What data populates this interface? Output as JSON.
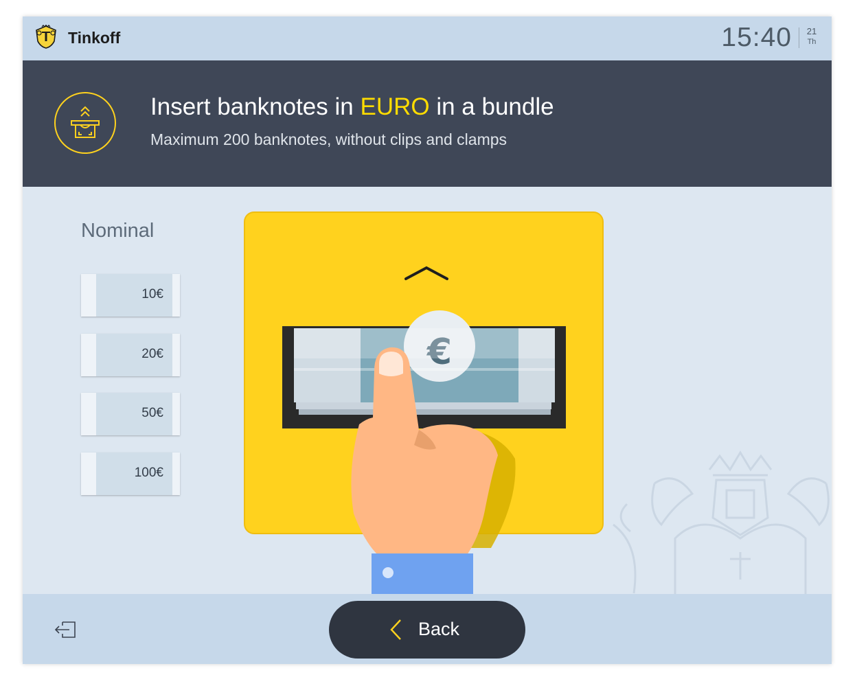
{
  "topbar": {
    "brand": "Tinkoff",
    "time": "15:40",
    "date_num": "21",
    "date_day": "Th"
  },
  "header": {
    "title_before": "Insert banknotes in ",
    "title_highlight": "EURO",
    "title_after": " in a bundle",
    "subtitle": "Maximum 200 banknotes, without clips and clamps",
    "highlight_color": "#ffdc00"
  },
  "nominal": {
    "label": "Nominal",
    "items": [
      "10€",
      "20€",
      "50€",
      "100€"
    ]
  },
  "illustration": {
    "currency_symbol": "€",
    "panel_color": "#ffd21e"
  },
  "footer": {
    "back_label": "Back",
    "exit_icon": "exit-icon",
    "back_icon": "chevron-left-icon"
  }
}
